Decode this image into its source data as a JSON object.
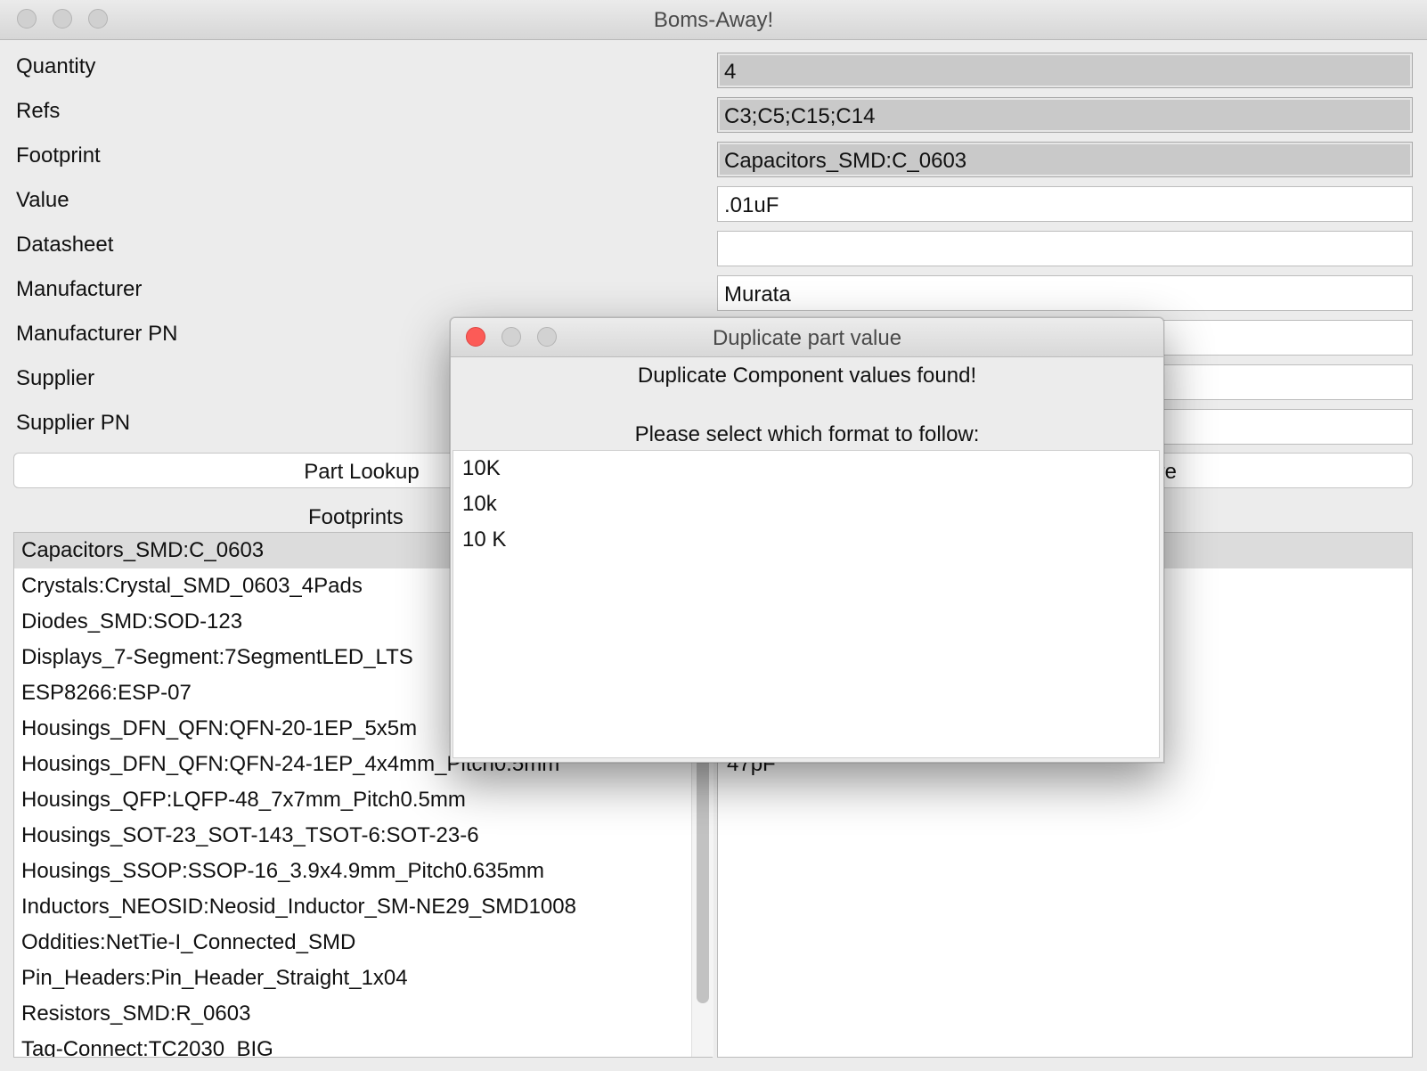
{
  "window": {
    "title": "Boms-Away!"
  },
  "fields": [
    {
      "label": "Quantity",
      "value": "4",
      "readonly": true
    },
    {
      "label": "Refs",
      "value": "C3;C5;C15;C14",
      "readonly": true
    },
    {
      "label": "Footprint",
      "value": "Capacitors_SMD:C_0603",
      "readonly": true
    },
    {
      "label": "Value",
      "value": ".01uF",
      "readonly": false
    },
    {
      "label": "Datasheet",
      "value": "",
      "readonly": false
    },
    {
      "label": "Manufacturer",
      "value": "Murata",
      "readonly": false
    },
    {
      "label": "Manufacturer PN",
      "value": "",
      "readonly": false
    },
    {
      "label": "Supplier",
      "value": "",
      "readonly": false
    },
    {
      "label": "Supplier PN",
      "value": "",
      "readonly": false
    }
  ],
  "buttons": {
    "part_lookup": "Part Lookup",
    "right_partial": "re"
  },
  "footprints": {
    "title": "Footprints",
    "items": [
      "Capacitors_SMD:C_0603",
      "Crystals:Crystal_SMD_0603_4Pads",
      "Diodes_SMD:SOD-123",
      "Displays_7-Segment:7SegmentLED_LTS",
      "ESP8266:ESP-07",
      "Housings_DFN_QFN:QFN-20-1EP_5x5m",
      "Housings_DFN_QFN:QFN-24-1EP_4x4mm_Pitch0.5mm",
      "Housings_QFP:LQFP-48_7x7mm_Pitch0.5mm",
      "Housings_SOT-23_SOT-143_TSOT-6:SOT-23-6",
      "Housings_SSOP:SSOP-16_3.9x4.9mm_Pitch0.635mm",
      "Inductors_NEOSID:Neosid_Inductor_SM-NE29_SMD1008",
      "Oddities:NetTie-I_Connected_SMD",
      "Pin_Headers:Pin_Header_Straight_1x04",
      "Resistors_SMD:R_0603",
      "Tag-Connect:TC2030_BIG"
    ],
    "selected_index": 0
  },
  "values": {
    "visible_item": "47pF"
  },
  "dialog": {
    "title": "Duplicate part value",
    "message1": "Duplicate Component values found!",
    "message2": "Please select which format to follow:",
    "options": [
      "10K",
      "10k",
      "10 K"
    ]
  }
}
